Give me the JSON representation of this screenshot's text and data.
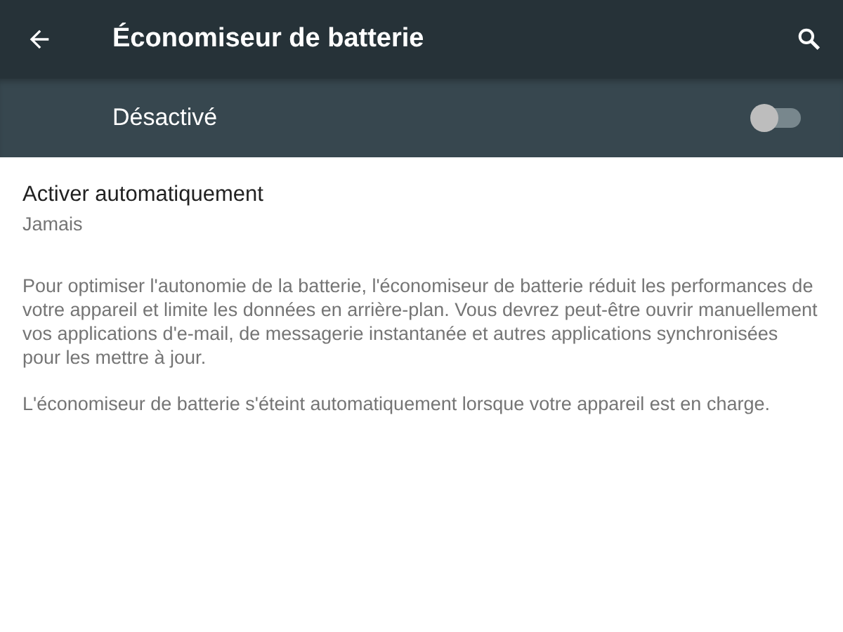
{
  "app_bar": {
    "title": "Économiseur de batterie"
  },
  "master_switch": {
    "label": "Désactivé",
    "on": false
  },
  "settings": [
    {
      "title": "Activer automatiquement",
      "summary": "Jamais"
    }
  ],
  "footer_texts": [
    "Pour optimiser l'autonomie de la batterie, l'économiseur de batterie réduit les performances de votre appareil et limite les données en arrière-plan. Vous devrez peut-être ouvrir manuellement vos applications d'e-mail, de messagerie instantanée et autres applications synchronisées pour les mettre à jour.",
    "L'économiseur de batterie s'éteint automatiquement lorsque votre appareil est en charge."
  ]
}
